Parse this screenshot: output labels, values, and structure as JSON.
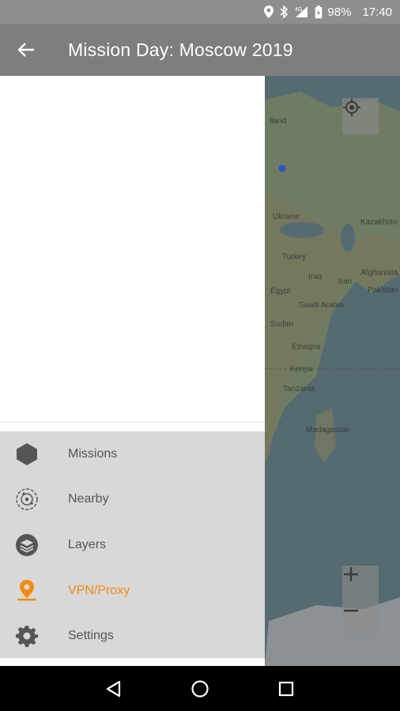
{
  "status_bar": {
    "battery": "98%",
    "time": "17:40",
    "icons": [
      "location-icon",
      "bluetooth-icon",
      "signal-icon",
      "battery-icon"
    ]
  },
  "app_bar": {
    "title": "Mission Day: Moscow 2019",
    "back_icon": "arrow-left-icon"
  },
  "map": {
    "labels": [
      "lland",
      "Ukraine",
      "Kazakhsto",
      "Turkey",
      "Iraq",
      "Iran",
      "Afghanista",
      "Egypt",
      "Pakistan",
      "Saudi Arabia",
      "Sudan",
      "Ethiopia",
      "Kenya",
      "Tanzania",
      "Madagascar"
    ],
    "zoom_in": "+",
    "zoom_out": "−"
  },
  "drawer": {
    "menu": [
      {
        "label": "Missions",
        "icon": "hexagon-icon",
        "active": false
      },
      {
        "label": "Nearby",
        "icon": "nearby-icon",
        "active": false
      },
      {
        "label": "Layers",
        "icon": "layers-icon",
        "active": false
      },
      {
        "label": "VPN/Proxy",
        "icon": "vpn-icon",
        "active": true
      },
      {
        "label": "Settings",
        "icon": "gear-icon",
        "active": false
      }
    ]
  },
  "colors": {
    "accent": "#f08b10",
    "app_bar": "#7e7e7e",
    "status_bar": "#8e8e8e",
    "menu_bg": "#d8d8d8"
  },
  "nav_bar": {
    "buttons": [
      "back-triangle-icon",
      "home-circle-icon",
      "recents-square-icon"
    ]
  }
}
